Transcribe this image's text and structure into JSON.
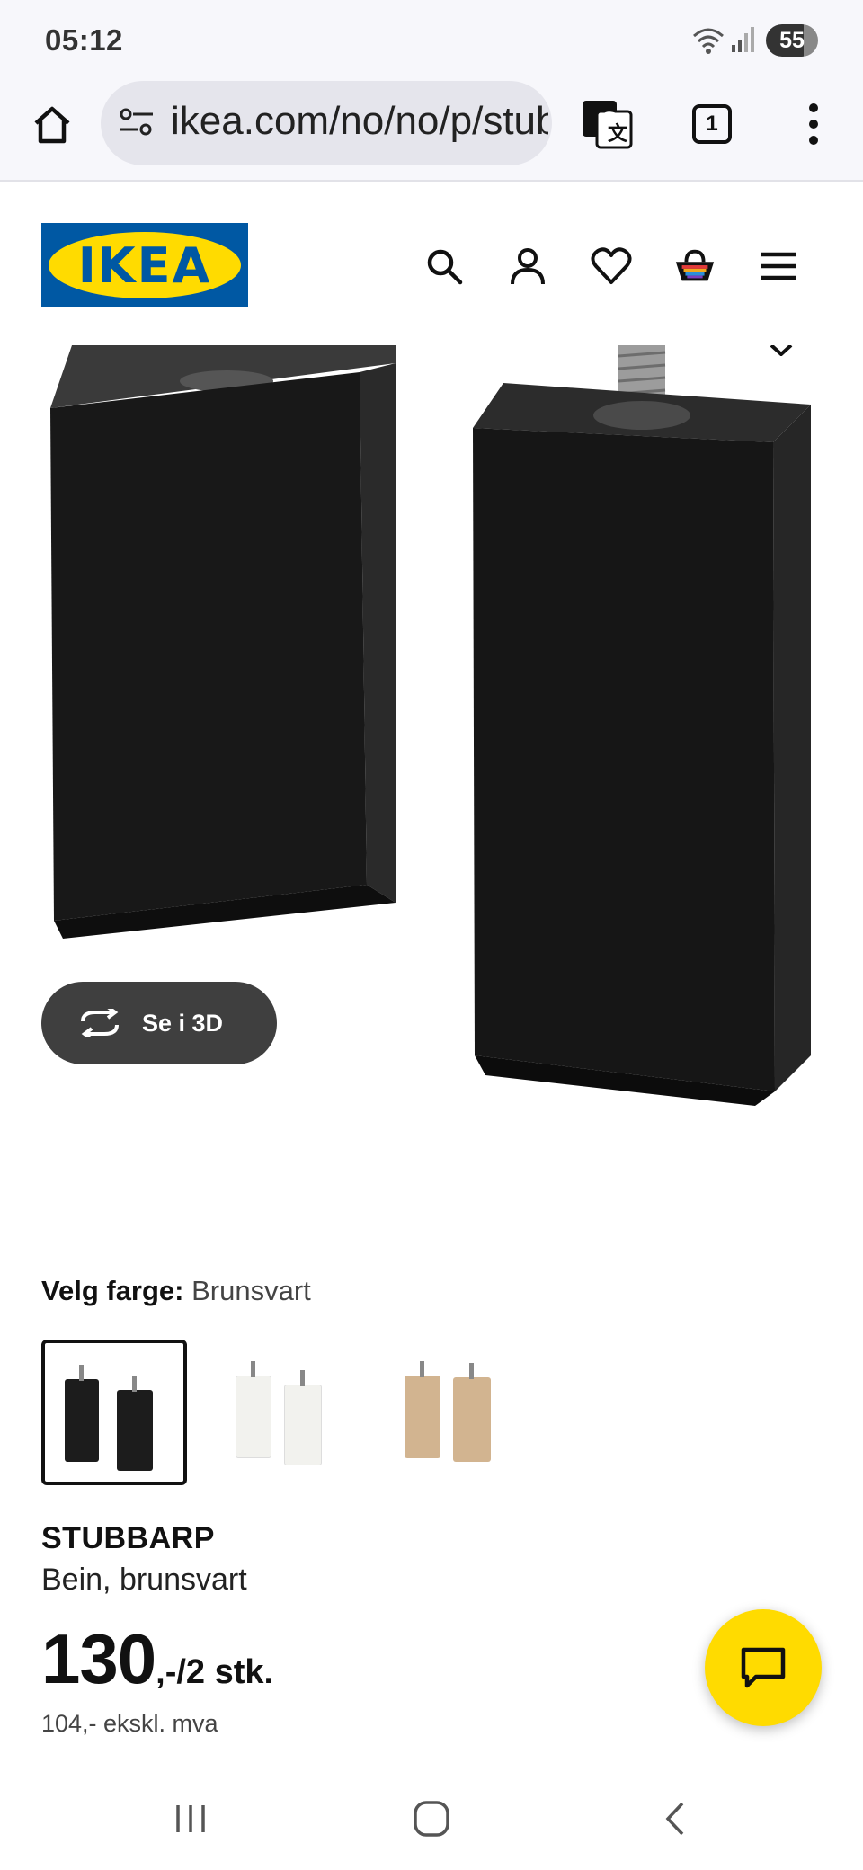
{
  "status_bar": {
    "time": "05:12",
    "battery": "55"
  },
  "browser": {
    "url": "ikea.com/no/no/p/stubbarp",
    "tab_count": "1"
  },
  "site": {
    "logo_text": "IKEA"
  },
  "gallery": {
    "see_3d_label": "Se i 3D",
    "dots": 3,
    "active_dot": 0
  },
  "product": {
    "color_label": "Velg farge:",
    "color_value": "Brunsvart",
    "swatches": [
      {
        "name": "Brunsvart",
        "color": "#1c1c1c"
      },
      {
        "name": "Hvit",
        "color": "#f2f2ee"
      },
      {
        "name": "Bjørk",
        "color": "#d2b490"
      }
    ],
    "name": "STUBBARP",
    "description": "Bein, brunsvart",
    "price_main": "130",
    "price_suffix": ",-/2 stk.",
    "price_ex_vat": "104,- ekskl. mva"
  },
  "colors": {
    "ikea_blue": "#0058a3",
    "ikea_yellow": "#ffdb00"
  },
  "icons": [
    "home-icon",
    "site-settings-icon",
    "translate-icon",
    "tabs-icon",
    "more-vert-icon",
    "search-icon",
    "profile-icon",
    "heart-icon",
    "cart-icon",
    "menu-icon",
    "rotate-3d-icon",
    "chat-icon"
  ]
}
